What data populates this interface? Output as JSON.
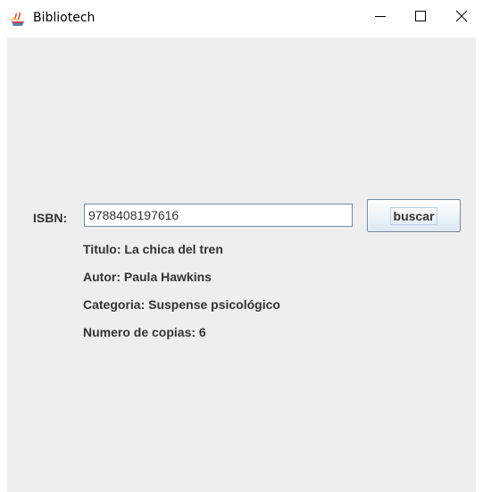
{
  "window": {
    "title": "Bibliotech",
    "minimize_icon": "minimize-icon",
    "maximize_icon": "maximize-icon",
    "close_icon": "close-icon",
    "app_icon": "java-cup-icon"
  },
  "form": {
    "isbn_label": "ISBN:",
    "isbn_value": "9788408197616",
    "search_button_label": "buscar"
  },
  "book": {
    "titulo": "Titulo: La chica del tren",
    "autor": "Autor: Paula Hawkins",
    "categoria": "Categoria: Suspense psicológico",
    "copias": "Numero de copias: 6"
  },
  "colors": {
    "client_background": "#eeeeee",
    "text": "#333333",
    "button_gradient_bottom": "#dde8f3",
    "border": "#7a8a99"
  }
}
